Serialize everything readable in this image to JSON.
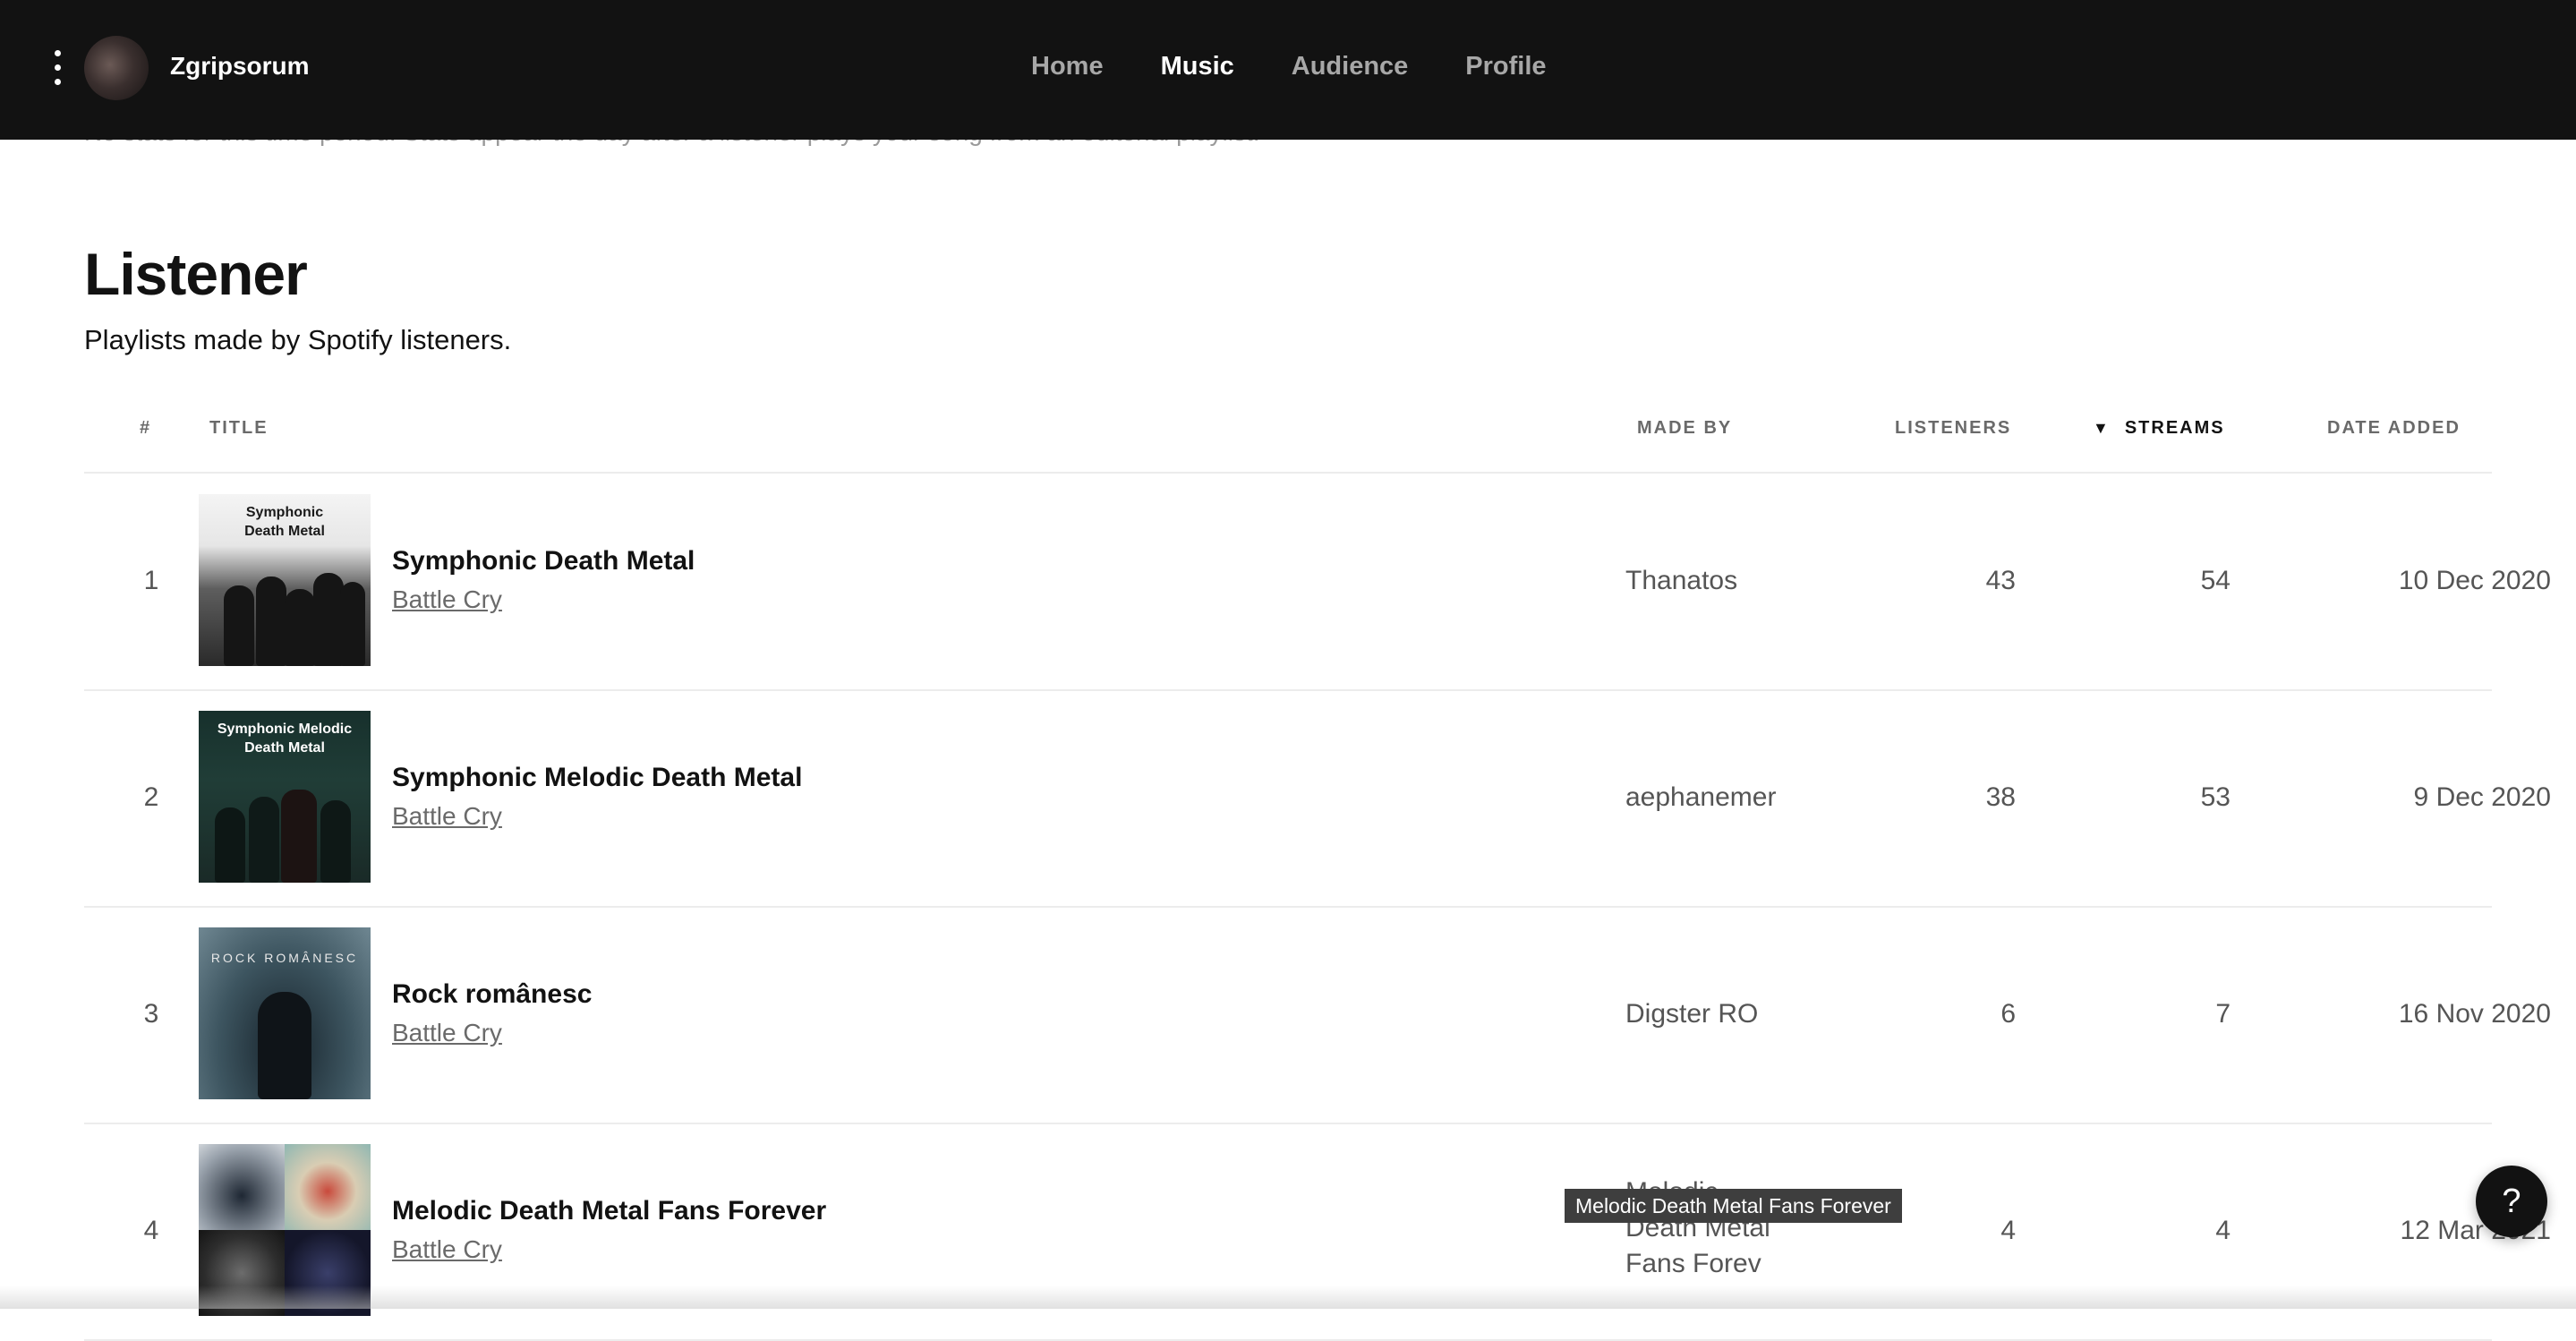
{
  "header": {
    "menu_icon": "more-vertical-icon",
    "artist_name": "Zgripsorum",
    "nav": [
      {
        "label": "Home",
        "active": false
      },
      {
        "label": "Music",
        "active": true
      },
      {
        "label": "Audience",
        "active": false
      },
      {
        "label": "Profile",
        "active": false
      }
    ]
  },
  "editorial_note": "No stats for this time period. Stats appear the day after a listener plays your song from an editorial playlist.",
  "section": {
    "title": "Listener",
    "description": "Playlists made by Spotify listeners."
  },
  "table": {
    "columns": {
      "num": "#",
      "title": "TITLE",
      "made_by": "MADE BY",
      "listeners": "LISTENERS",
      "streams": "STREAMS",
      "date_added": "DATE ADDED"
    },
    "sort": {
      "column": "streams",
      "direction": "descending",
      "icon": "sort-down-triangle-icon"
    },
    "rows": [
      {
        "num": "1",
        "cover_text": "Symphonic Death Metal",
        "title": "Symphonic Death Metal",
        "song": "Battle Cry",
        "made_by": "Thanatos",
        "listeners": "43",
        "streams": "54",
        "date_added": "10 Dec 2020"
      },
      {
        "num": "2",
        "cover_text": "Symphonic Melodic Death Metal",
        "title": "Symphonic Melodic Death Metal",
        "song": "Battle Cry",
        "made_by": "aephanemer",
        "listeners": "38",
        "streams": "53",
        "date_added": "9 Dec 2020"
      },
      {
        "num": "3",
        "cover_text": "ROCK ROMÂNESC",
        "title": "Rock românesc",
        "song": "Battle Cry",
        "made_by": "Digster RO",
        "listeners": "6",
        "streams": "7",
        "date_added": "16 Nov 2020"
      },
      {
        "num": "4",
        "cover_text": "",
        "title": "Melodic Death Metal Fans Forever",
        "song": "Battle Cry",
        "made_by_lines": [
          "Melodic",
          "Death Metal",
          "Fans Forev"
        ],
        "listeners": "4",
        "streams": "4",
        "date_added": "12 Mar 2021"
      }
    ]
  },
  "tooltip": "Melodic Death Metal Fans Forever",
  "help_button": {
    "label": "?",
    "icon": "help-icon"
  }
}
